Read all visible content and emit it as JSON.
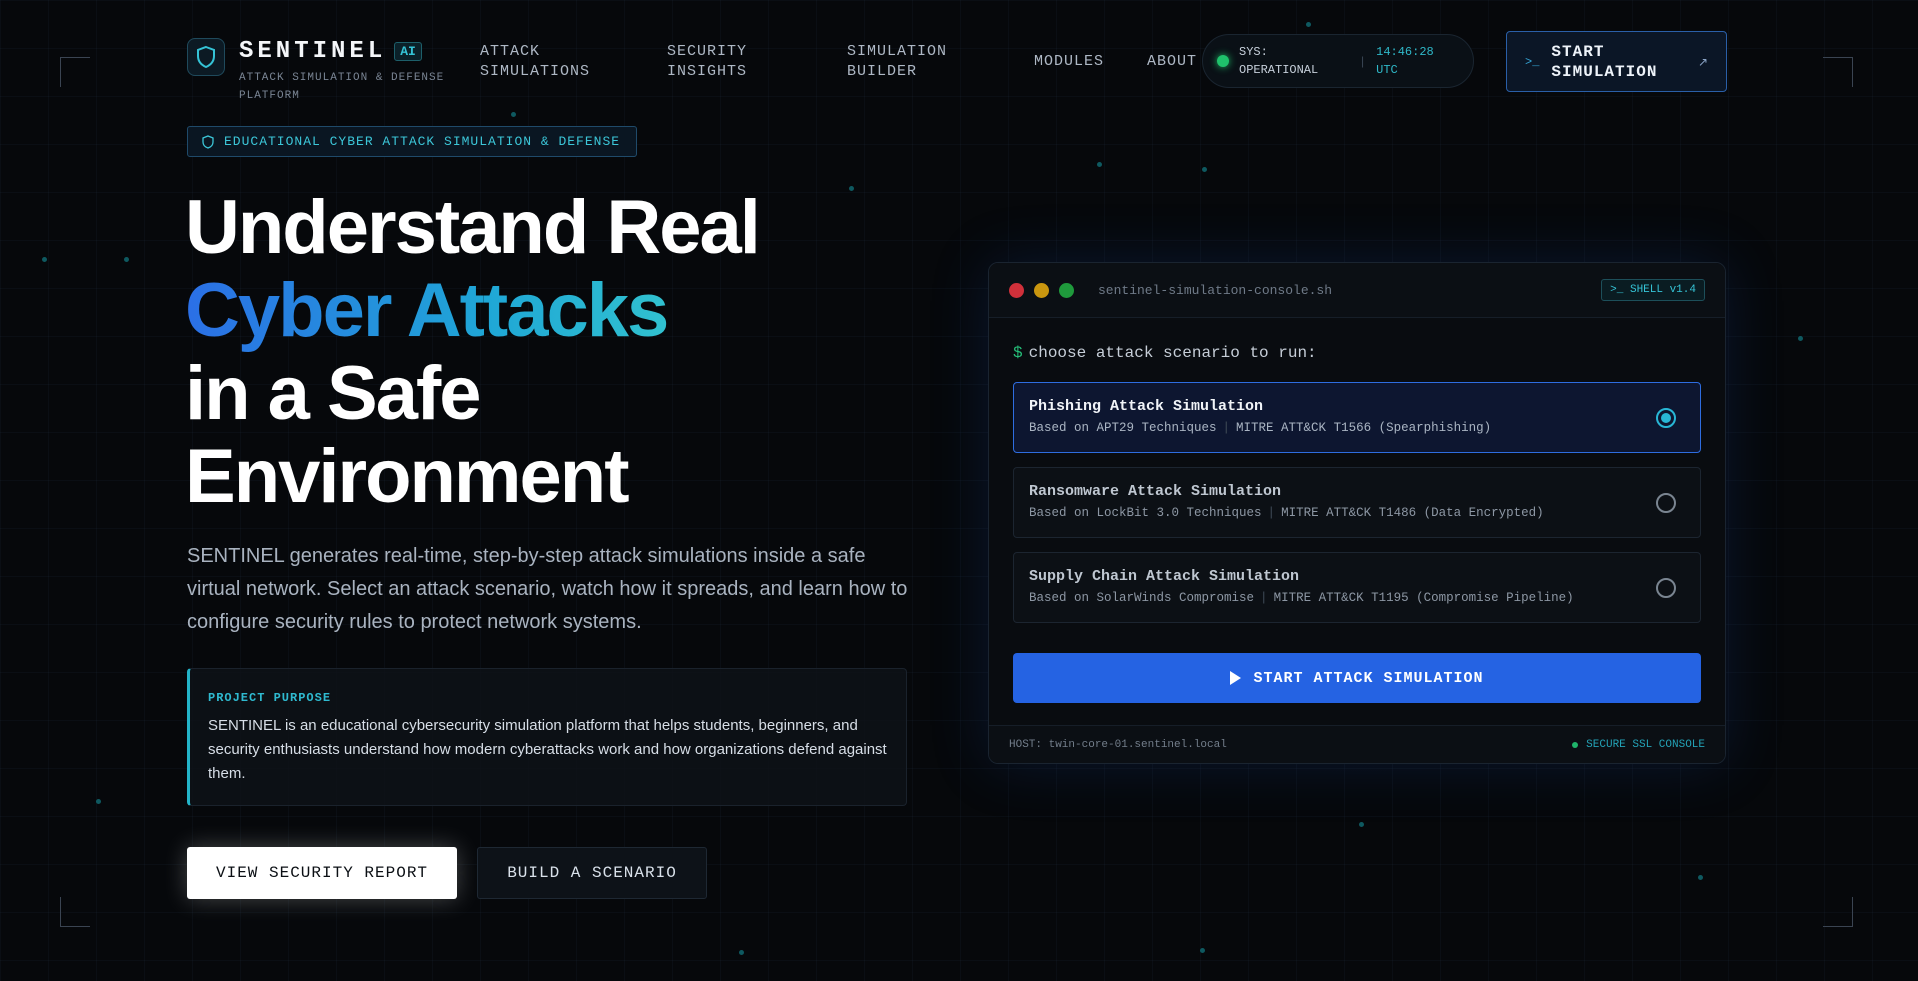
{
  "brand": {
    "name": "SENTINEL",
    "badge": "AI",
    "subtitle": "ATTACK SIMULATION & DEFENSE PLATFORM"
  },
  "nav": {
    "items": [
      {
        "label": "ATTACK SIMULATIONS"
      },
      {
        "label": "SECURITY INSIGHTS"
      },
      {
        "label": "SIMULATION BUILDER"
      },
      {
        "label": "MODULES"
      },
      {
        "label": "ABOUT"
      }
    ]
  },
  "status": {
    "label": "SYS: OPERATIONAL",
    "separator": "|",
    "time": "14:46:28 UTC"
  },
  "header_cta": {
    "prompt": ">_",
    "label": "START SIMULATION",
    "arrow": "↗"
  },
  "hero": {
    "tag": "EDUCATIONAL CYBER ATTACK SIMULATION & DEFENSE",
    "headline_line1": "Understand Real",
    "headline_highlight": "Cyber Attacks",
    "headline_line3": "in a Safe",
    "headline_line4": "Environment",
    "description": "SENTINEL generates real-time, step-by-step attack simulations inside a safe virtual network. Select an attack scenario, watch how it spreads, and learn how to configure security rules to protect network systems.",
    "purpose_label": "PROJECT PURPOSE",
    "purpose_text": "SENTINEL is an educational cybersecurity simulation platform that helps students, beginners, and security enthusiasts understand how modern cyberattacks work and how organizations defend against them.",
    "primary_button": "VIEW SECURITY REPORT",
    "secondary_button": "BUILD A SCENARIO"
  },
  "console": {
    "filename": "sentinel-simulation-console.sh",
    "shell_badge": ">_ SHELL v1.4",
    "prompt_symbol": "$",
    "prompt": "choose attack scenario to run:",
    "scenarios": [
      {
        "title": "Phishing Attack Simulation",
        "basis": "Based on APT29 Techniques",
        "mitre": "MITRE ATT&CK T1566 (Spearphishing)",
        "selected": true
      },
      {
        "title": "Ransomware Attack Simulation",
        "basis": "Based on LockBit 3.0 Techniques",
        "mitre": "MITRE ATT&CK T1486 (Data Encrypted)",
        "selected": false
      },
      {
        "title": "Supply Chain Attack Simulation",
        "basis": "Based on SolarWinds Compromise",
        "mitre": "MITRE ATT&CK T1195 (Compromise Pipeline)",
        "selected": false
      }
    ],
    "run_button": "START ATTACK SIMULATION",
    "host": "HOST: twin-core-01.sentinel.local",
    "secure": "SECURE SSL CONSOLE"
  },
  "colors": {
    "accent": "#2563e3",
    "cyan": "#28b7d6",
    "background": "#06080b",
    "status_ok": "#1fc16b"
  },
  "icons": {
    "logo": "shield-icon",
    "tag": "shield-outline-icon",
    "cta_prompt": "terminal-icon",
    "cta_arrow": "arrow-up-right-icon",
    "run": "play-icon"
  }
}
